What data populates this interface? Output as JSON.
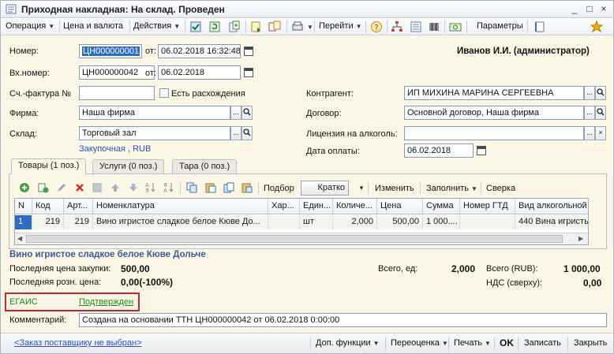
{
  "window": {
    "title": "Приходная накладная: На склад. Проведен"
  },
  "toolbar": {
    "operation": "Операция",
    "price_currency": "Цена и валюта",
    "actions": "Действия",
    "goto": "Перейти",
    "params": "Параметры"
  },
  "header": {
    "number_label": "Номер:",
    "number_value": "ЦН000000001",
    "from_label": "от:",
    "number_date": "06.02.2018 16:32:48",
    "user": "Иванов И.И. (администратор)",
    "in_number_label": "Вх.номер:",
    "in_number_value": "ЦН000000042",
    "in_from_label": "от:",
    "in_number_date": "06.02.2018",
    "invoice_label": "Сч.-фактура №",
    "invoice_value": "",
    "discrepancies_label": "Есть расхождения",
    "firm_label": "Фирма:",
    "firm_value": "Наша фирма",
    "warehouse_label": "Склад:",
    "warehouse_value": "Торговый зал",
    "price_link": "Закупочная , RUB",
    "counterparty_label": "Контрагент:",
    "counterparty_value": "ИП МИХИНА МАРИНА СЕРГЕЕВНА",
    "contract_label": "Договор:",
    "contract_value": "Основной договор, Наша фирма",
    "license_label": "Лицензия на алкоголь:",
    "license_value": "",
    "pay_date_label": "Дата оплаты:",
    "pay_date_value": "06.02.2018"
  },
  "tabs": [
    {
      "label": "Товары (1 поз.)",
      "active": true
    },
    {
      "label": "Услуги (0 поз.)",
      "active": false
    },
    {
      "label": "Тара (0 поз.)",
      "active": false
    }
  ],
  "grid_toolbar": {
    "selection": "Подбор",
    "short": "Кратко",
    "change": "Изменить",
    "fill": "Заполнить",
    "check": "Сверка"
  },
  "table": {
    "columns": [
      "N",
      "Код",
      "Арт...",
      "Номенклатура",
      "Хар...",
      "Един...",
      "Количе...",
      "Цена",
      "Сумма",
      "Номер ГТД",
      "Вид алкогольной"
    ],
    "rows": [
      [
        "1",
        "219",
        "219",
        "Вино игристое сладкое белое Кюве До...",
        "",
        "шт",
        "2,000",
        "500,00",
        "1 000....",
        "",
        "440 Вина игристь"
      ]
    ]
  },
  "summary": {
    "product_name": "Вино игристое сладкое белое Кюве Дольче",
    "last_purchase_label": "Последняя цена закупки:",
    "last_purchase_value": "500,00",
    "last_retail_label": "Последняя розн. цена:",
    "last_retail_value": "0,00(-100%)",
    "total_units_label": "Всего, ед:",
    "total_units_value": "2,000",
    "total_label": "Всего (RUB):",
    "total_value": "1 000,00",
    "vat_label": "НДС (сверху):",
    "vat_value": "0,00"
  },
  "egais": {
    "label": "ЕГАИС",
    "status": "Подтвержден"
  },
  "comment": {
    "label": "Комментарий:",
    "value": "Создана на основании ТТН ЦН000000042 от 06.02.2018 0:00:00"
  },
  "bottombar": {
    "order_link": "<Заказ поставщику не выбран>",
    "extra_functions": "Доп. функции",
    "reprice": "Переоценка",
    "print": "Печать",
    "ok": "OK",
    "save": "Записать",
    "close": "Закрыть"
  },
  "colors": {
    "accent": "#316ac5",
    "link": "#2a52be",
    "egais_green": "#1b8a1b",
    "highlight": "#c0282d"
  }
}
